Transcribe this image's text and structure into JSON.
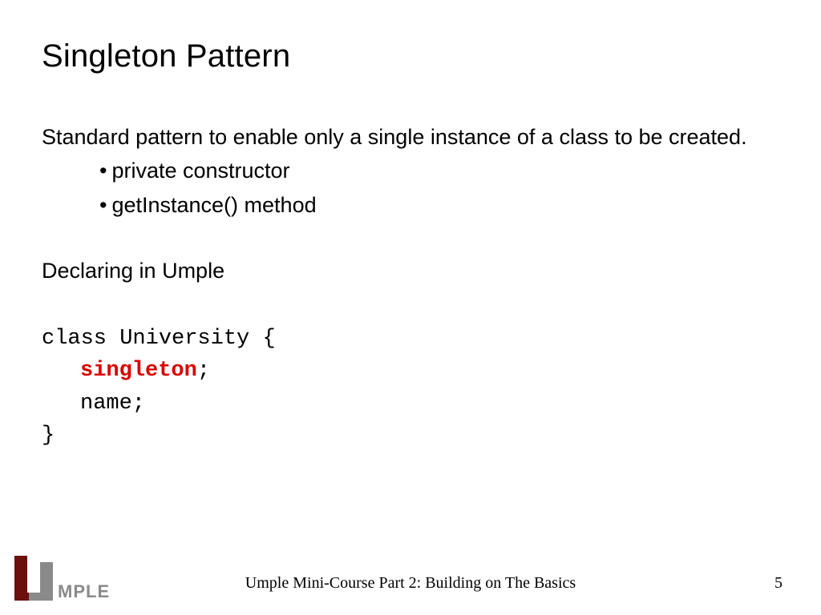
{
  "title": "Singleton Pattern",
  "description": "Standard pattern to enable only a single instance of a class to be created.",
  "bullets": [
    "private constructor",
    "getInstance() method"
  ],
  "section": "Declaring in Umple",
  "code": {
    "line1": "class University {",
    "keyword": "singleton",
    "semi1": ";",
    "line3": "name;",
    "line4": "}"
  },
  "footer": {
    "course": "Umple Mini-Course Part 2: Building on The Basics",
    "page": "5",
    "logo_text": "MPLE"
  }
}
